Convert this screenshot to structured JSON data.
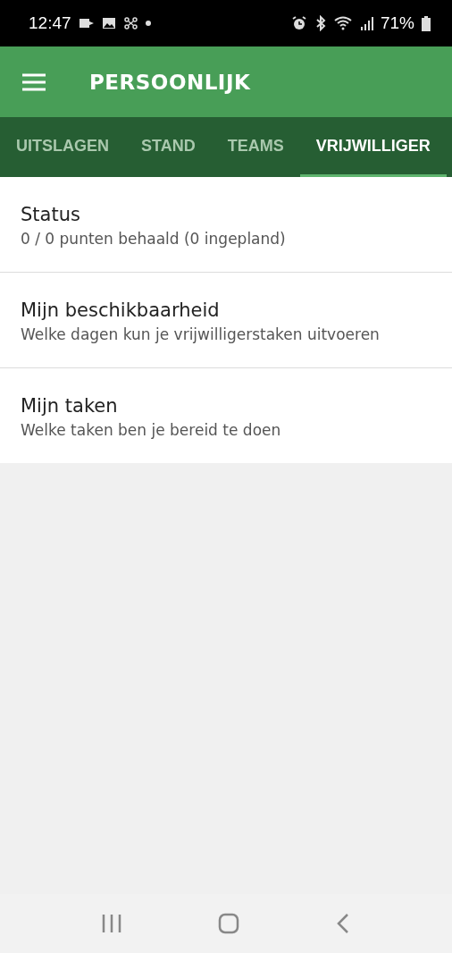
{
  "status_bar": {
    "time": "12:47",
    "battery": "71%"
  },
  "app_bar": {
    "title": "PERSOONLIJK"
  },
  "tabs": [
    {
      "label": "UITSLAGEN",
      "selected": false
    },
    {
      "label": "STAND",
      "selected": false
    },
    {
      "label": "TEAMS",
      "selected": false
    },
    {
      "label": "VRIJWILLIGER",
      "selected": true
    }
  ],
  "items": [
    {
      "title": "Status",
      "subtitle": "0 / 0 punten behaald (0 ingepland)"
    },
    {
      "title": "Mijn beschikbaarheid",
      "subtitle": "Welke dagen kun je vrijwilligerstaken uitvoeren"
    },
    {
      "title": "Mijn taken",
      "subtitle": "Welke taken ben je bereid te doen"
    }
  ]
}
